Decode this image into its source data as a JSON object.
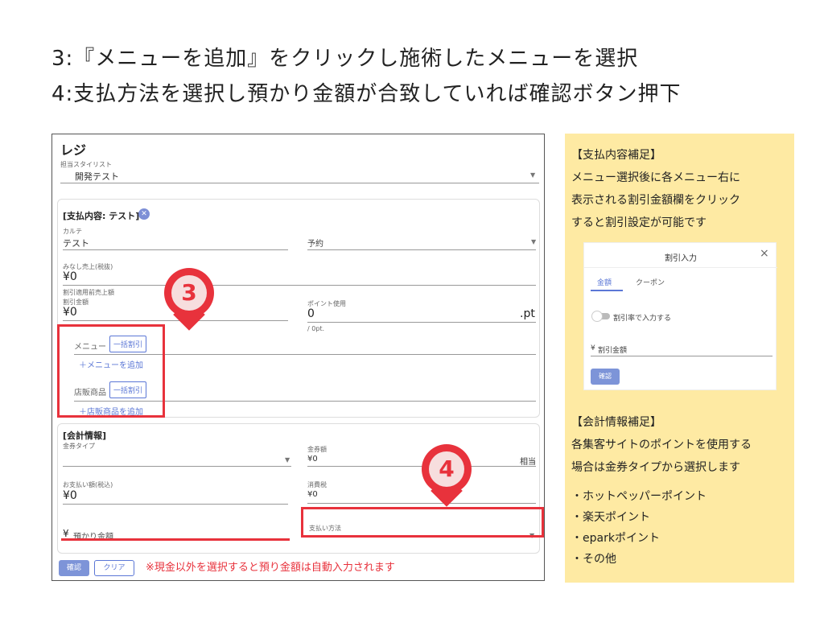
{
  "headline": {
    "step3": "3:『メニューを追加』をクリックし施術したメニューを選択",
    "step4": "4:支払方法を選択し預かり金額が合致していれば確認ボタン押下"
  },
  "register": {
    "title": "レジ",
    "stylist_label": "担当スタイリスト",
    "stylist_value": "開発テスト",
    "payment_header": "[支払内容: テスト]",
    "karte_label": "カルテ",
    "karte_value": "テスト",
    "reservation_placeholder": "予約",
    "deemed_sales_label": "みなし売上(税抜)",
    "deemed_sales_value": "¥0",
    "pre_discount_label": "割引適用前売上額",
    "discount_label": "割引金額",
    "discount_value": "¥0",
    "point_label": "ポイント使用",
    "point_value": "0",
    "point_unit": ".pt",
    "point_hint": "/ 0pt.",
    "menu_label": "メニュー",
    "bulk_discount": "一括割引",
    "add_menu": "＋メニューを追加",
    "retail_label": "店販商品",
    "add_retail": "＋店販商品を追加",
    "accounting_header": "[会計情報]",
    "voucher_type_label": "金券タイプ",
    "voucher_amount_label": "金券額",
    "voucher_amount_value": "¥0",
    "voucher_suffix": "相当",
    "payment_amount_label": "お支払い額(税込)",
    "payment_amount_value": "¥0",
    "tax_label": "消費税",
    "tax_value": "¥0",
    "deposit_prefix": "¥",
    "deposit_placeholder": "預かり金額",
    "payment_method_label": "支払い方法",
    "confirm_button": "確認",
    "clear_button": "クリア",
    "note": "※現金以外を選択すると預り金額は自動入力されます"
  },
  "markers": {
    "m3": "3",
    "m4": "4"
  },
  "side": {
    "title1": "【支払内容補足】",
    "line1": "メニュー選択後に各メニュー右に",
    "line2": "表示される割引金額欄をクリック",
    "line3": "すると割引設定が可能です",
    "dialog": {
      "title": "割引入力",
      "close": "×",
      "tab_amount": "金額",
      "tab_coupon": "クーポン",
      "toggle_label": "割引率で入力する",
      "field_prefix": "¥",
      "field_label": "割引金額",
      "confirm": "確認"
    },
    "title2": "【会計情報補足】",
    "line4": "各集客サイトのポイントを使用する",
    "line5": "場合は金券タイプから選択します",
    "bullets": [
      "・ホットペッパーポイント",
      "・楽天ポイント",
      "・eparkポイント",
      "・その他"
    ]
  },
  "colors": {
    "accent_red": "#e8323c",
    "brand_blue": "#5b77d6",
    "note_bg": "#feeaa3"
  }
}
